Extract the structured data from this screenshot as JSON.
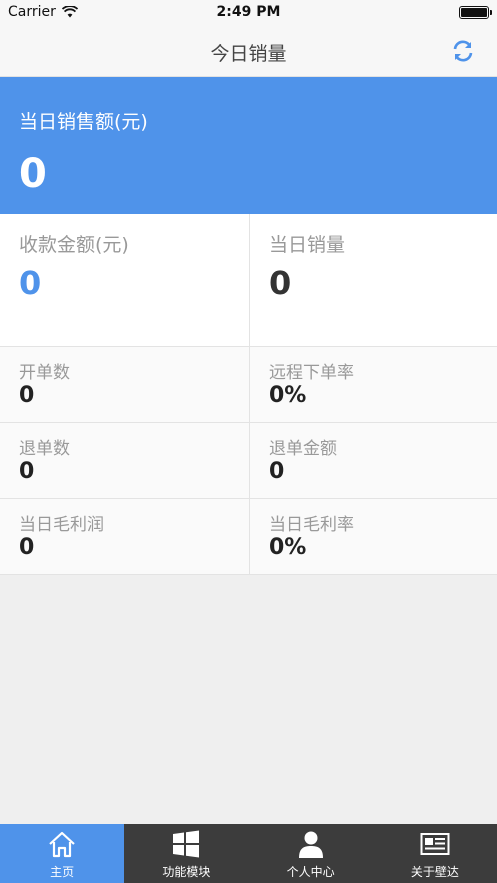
{
  "status_bar": {
    "carrier": "Carrier",
    "time": "2:49 PM"
  },
  "nav": {
    "title": "今日销量",
    "refresh_icon": "refresh-icon"
  },
  "hero": {
    "label": "当日销售额(元)",
    "value": "0"
  },
  "top_cells": [
    {
      "label": "收款金额(元)",
      "value": "0"
    },
    {
      "label": "当日销量",
      "value": "0"
    }
  ],
  "stats": [
    {
      "label": "开单数",
      "value": "0"
    },
    {
      "label": "远程下单率",
      "value": "0%"
    },
    {
      "label": "退单数",
      "value": "0"
    },
    {
      "label": "退单金额",
      "value": "0"
    },
    {
      "label": "当日毛利润",
      "value": "0"
    },
    {
      "label": "当日毛利率",
      "value": "0%"
    }
  ],
  "tabs": [
    {
      "label": "主页",
      "icon": "home-icon",
      "active": true
    },
    {
      "label": "功能模块",
      "icon": "windows-icon",
      "active": false
    },
    {
      "label": "个人中心",
      "icon": "user-icon",
      "active": false
    },
    {
      "label": "关于壁达",
      "icon": "card-icon",
      "active": false
    }
  ],
  "colors": {
    "accent": "#4f93ea",
    "tab_bar": "#3c3c3c"
  }
}
